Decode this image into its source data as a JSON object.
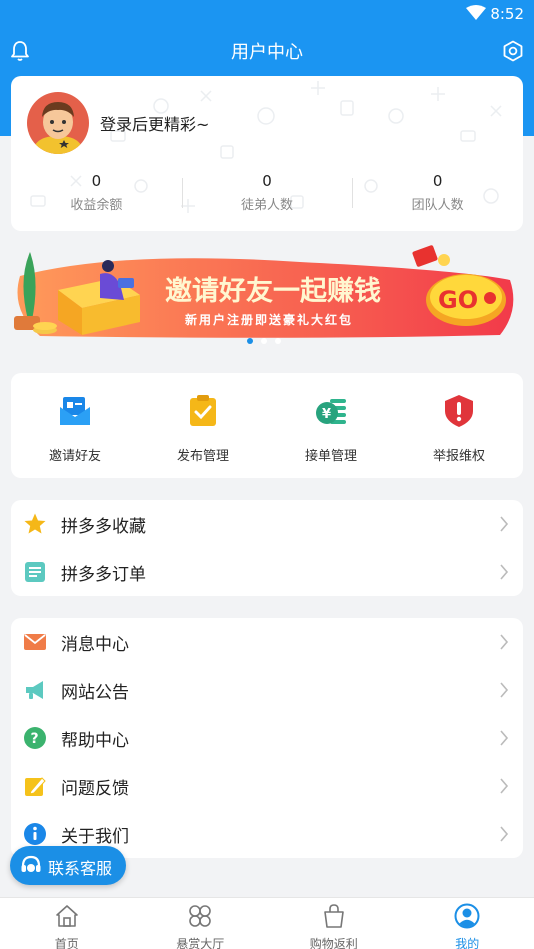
{
  "status_bar": {
    "time": "8:52"
  },
  "header": {
    "title": "用户中心"
  },
  "user": {
    "login_prompt": "登录后更精彩~",
    "stats": [
      {
        "value": "0",
        "label": "收益余额"
      },
      {
        "value": "0",
        "label": "徒弟人数"
      },
      {
        "value": "0",
        "label": "团队人数"
      }
    ]
  },
  "banner": {
    "headline": "邀请好友一起赚钱",
    "subline": "新用户注册即送豪礼大红包",
    "go_label": "GO",
    "page_count": 3,
    "active_page": 1
  },
  "quick_actions": [
    {
      "label": "邀请好友",
      "icon": "invite-envelope-icon",
      "color": "#1a87e8"
    },
    {
      "label": "发布管理",
      "icon": "publish-clipboard-icon",
      "color": "#f5b718"
    },
    {
      "label": "接单管理",
      "icon": "order-money-icon",
      "color": "#2fb48d"
    },
    {
      "label": "举报维权",
      "icon": "report-shield-icon",
      "color": "#e0353b"
    }
  ],
  "pdd_list": [
    {
      "label": "拼多多收藏",
      "icon": "star-icon"
    },
    {
      "label": "拼多多订单",
      "icon": "order-list-icon"
    }
  ],
  "info_list": [
    {
      "label": "消息中心",
      "icon": "mail-icon"
    },
    {
      "label": "网站公告",
      "icon": "megaphone-icon"
    },
    {
      "label": "帮助中心",
      "icon": "help-icon"
    },
    {
      "label": "问题反馈",
      "icon": "feedback-pencil-icon"
    },
    {
      "label": "关于我们",
      "icon": "info-icon"
    }
  ],
  "service_button": {
    "label": "联系客服"
  },
  "tabs": [
    {
      "label": "首页",
      "icon": "home-icon",
      "active": false
    },
    {
      "label": "悬赏大厅",
      "icon": "bounty-hall-icon",
      "active": false
    },
    {
      "label": "购物返利",
      "icon": "shopping-bag-icon",
      "active": false
    },
    {
      "label": "我的",
      "icon": "profile-icon",
      "active": true
    }
  ],
  "colors": {
    "primary": "#1b95f2",
    "active_tab": "#1b8fe6"
  }
}
